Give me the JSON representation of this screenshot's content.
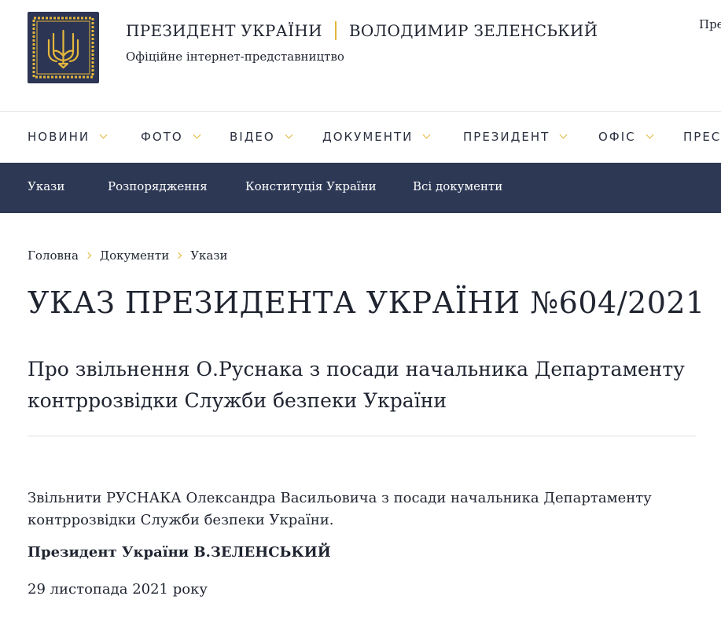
{
  "header": {
    "title_left": "ПРЕЗИДЕНТ УКРАЇНИ",
    "title_right": "ВОЛОДИМИР ЗЕЛЕНСЬКИЙ",
    "subtitle": "Офіційне інтернет-представництво",
    "lang_link": "Пре",
    "logo_icon": "trident-coat-of-arms-icon"
  },
  "main_nav": {
    "items": [
      {
        "label": "НОВИНИ"
      },
      {
        "label": "ФОТО"
      },
      {
        "label": "ВІДЕО"
      },
      {
        "label": "ДОКУМЕНТИ"
      },
      {
        "label": "ПРЕЗИДЕНТ"
      },
      {
        "label": "ОФІС"
      },
      {
        "label": "ПРЕС"
      }
    ]
  },
  "sub_nav": {
    "items": [
      {
        "label": "Укази"
      },
      {
        "label": "Розпорядження"
      },
      {
        "label": "Конституція України"
      },
      {
        "label": "Всі документи"
      }
    ]
  },
  "breadcrumb": {
    "items": [
      "Головна",
      "Документи",
      "Укази"
    ]
  },
  "content": {
    "title": "УКАЗ ПРЕЗИДЕНТА УКРАЇНИ №604/2021",
    "subject": "Про звільнення О.Руснака з посади начальника Департаменту контррозвідки Служби безпеки України",
    "body": "Звільнити РУСНАКА Олександра Васильовича з посади начальника Департаменту контррозвідки Служби безпеки України.",
    "signature": "Президент України В.ЗЕЛЕНСЬКИЙ",
    "date": "29 листопада 2021 року"
  },
  "colors": {
    "navy": "#2d3855",
    "logo_bg": "#2c3553",
    "gold": "#e4b63d",
    "text": "#1f2430",
    "divider": "#e0e2e7"
  }
}
